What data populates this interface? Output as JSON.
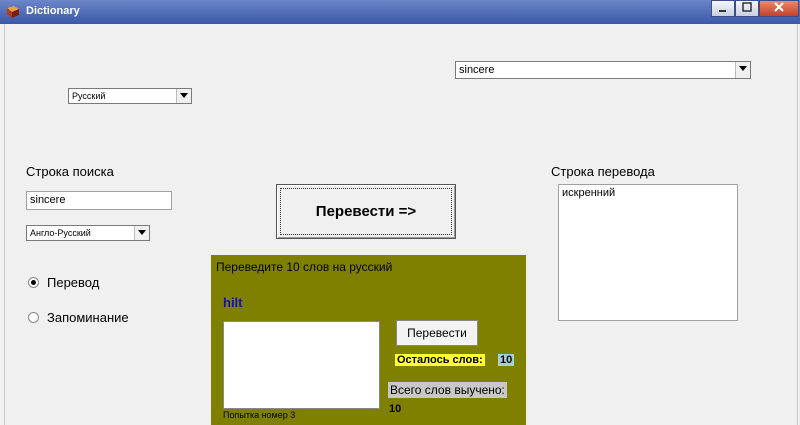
{
  "window": {
    "title": "Dictionary"
  },
  "top": {
    "suggestion_combo": "sincere",
    "language_combo": "Русский"
  },
  "search": {
    "label": "Строка поиска",
    "value": "sincere",
    "direction_combo": "Англо-Русский"
  },
  "translate_button": "Перевести =>",
  "translation": {
    "label": "Строка перевода",
    "value": "искренний"
  },
  "mode": {
    "options": [
      {
        "label": "Перевод",
        "selected": true
      },
      {
        "label": "Запоминание",
        "selected": false
      }
    ]
  },
  "quiz": {
    "prompt": "Переведите 10 слов на русский",
    "word": "hilt",
    "answer": "",
    "button": "Перевести",
    "remaining_label": "Осталось слов:",
    "remaining_value": "10",
    "learned_label": "Всего слов выучено:",
    "learned_value": "10",
    "attempt": "Попытка номер 3"
  },
  "colors": {
    "panel_bg": "#808000",
    "word_color": "#1010c0",
    "remaining_label_bg": "#ffff33",
    "remaining_value_bg": "#9fd4d4"
  }
}
